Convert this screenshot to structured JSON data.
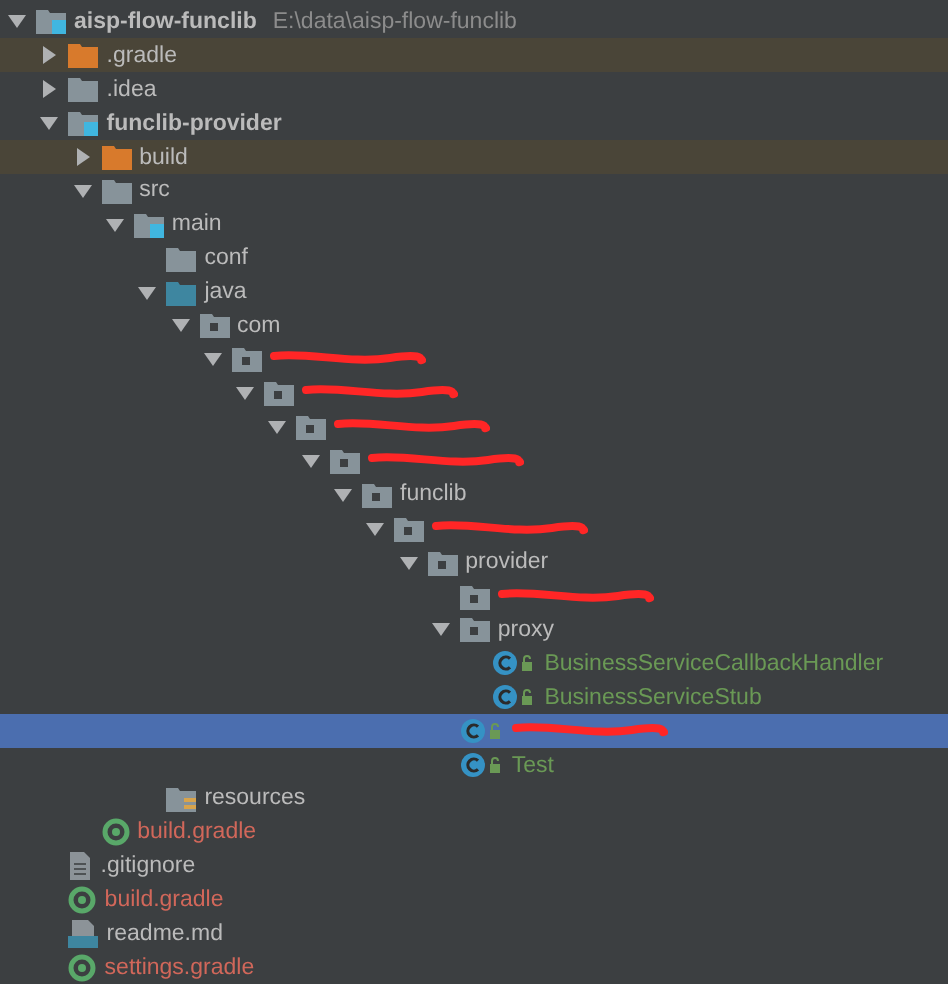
{
  "tree": [
    {
      "name": "aisp-flow-funclib",
      "path": "E:\\data\\aisp-flow-funclib",
      "kind": "module",
      "bold": true,
      "expanded": true,
      "children": [
        {
          "name": ".gradle",
          "kind": "excluded",
          "expanded": false,
          "ignored": true
        },
        {
          "name": ".idea",
          "kind": "folder",
          "expanded": false
        },
        {
          "name": "funclib-provider",
          "kind": "module",
          "bold": true,
          "expanded": true,
          "children": [
            {
              "name": "build",
              "kind": "excluded",
              "expanded": false,
              "ignored": true
            },
            {
              "name": "src",
              "kind": "folder",
              "expanded": true,
              "children": [
                {
                  "name": "main",
                  "kind": "module",
                  "expanded": true,
                  "children": [
                    {
                      "name": "conf",
                      "kind": "folder"
                    },
                    {
                      "name": "java",
                      "kind": "source",
                      "expanded": true,
                      "children": [
                        {
                          "name": "com",
                          "kind": "package",
                          "expanded": true,
                          "children": [
                            {
                              "redacted": true,
                              "kind": "package",
                              "expanded": true,
                              "children": [
                                {
                                  "redacted": true,
                                  "kind": "package",
                                  "expanded": true,
                                  "children": [
                                    {
                                      "redacted": true,
                                      "kind": "package",
                                      "expanded": true,
                                      "children": [
                                        {
                                          "redacted": true,
                                          "kind": "package",
                                          "expanded": true,
                                          "children": [
                                            {
                                              "name": "funclib",
                                              "kind": "package",
                                              "expanded": true,
                                              "children": [
                                                {
                                                  "redacted": true,
                                                  "kind": "package",
                                                  "expanded": true,
                                                  "children": [
                                                    {
                                                      "name": "provider",
                                                      "kind": "package",
                                                      "expanded": true,
                                                      "children": [
                                                        {
                                                          "redacted": true,
                                                          "kind": "package"
                                                        },
                                                        {
                                                          "name": "proxy",
                                                          "kind": "package",
                                                          "expanded": true,
                                                          "children": [
                                                            {
                                                              "name": "BusinessServiceCallbackHandler",
                                                              "kind": "class",
                                                              "color": "#6a9955"
                                                            },
                                                            {
                                                              "name": "BusinessServiceStub",
                                                              "kind": "class",
                                                              "color": "#6a9955"
                                                            }
                                                          ]
                                                        },
                                                        {
                                                          "redacted": true,
                                                          "kind": "class",
                                                          "selected": true
                                                        },
                                                        {
                                                          "name": "Test",
                                                          "kind": "class",
                                                          "color": "#6a9955"
                                                        }
                                                      ]
                                                    }
                                                  ]
                                                }
                                              ]
                                            }
                                          ]
                                        }
                                      ]
                                    }
                                  ]
                                }
                              ]
                            }
                          ]
                        }
                      ]
                    },
                    {
                      "name": "resources",
                      "kind": "resources"
                    }
                  ]
                }
              ]
            },
            {
              "name": "build.gradle",
              "kind": "gradle",
              "color": "#d1675a"
            }
          ]
        },
        {
          "name": ".gitignore",
          "kind": "text"
        },
        {
          "name": "build.gradle",
          "kind": "gradle",
          "color": "#d1675a"
        },
        {
          "name": "readme.md",
          "kind": "markdown"
        },
        {
          "name": "settings.gradle",
          "kind": "gradle",
          "color": "#d1675a"
        }
      ]
    }
  ]
}
